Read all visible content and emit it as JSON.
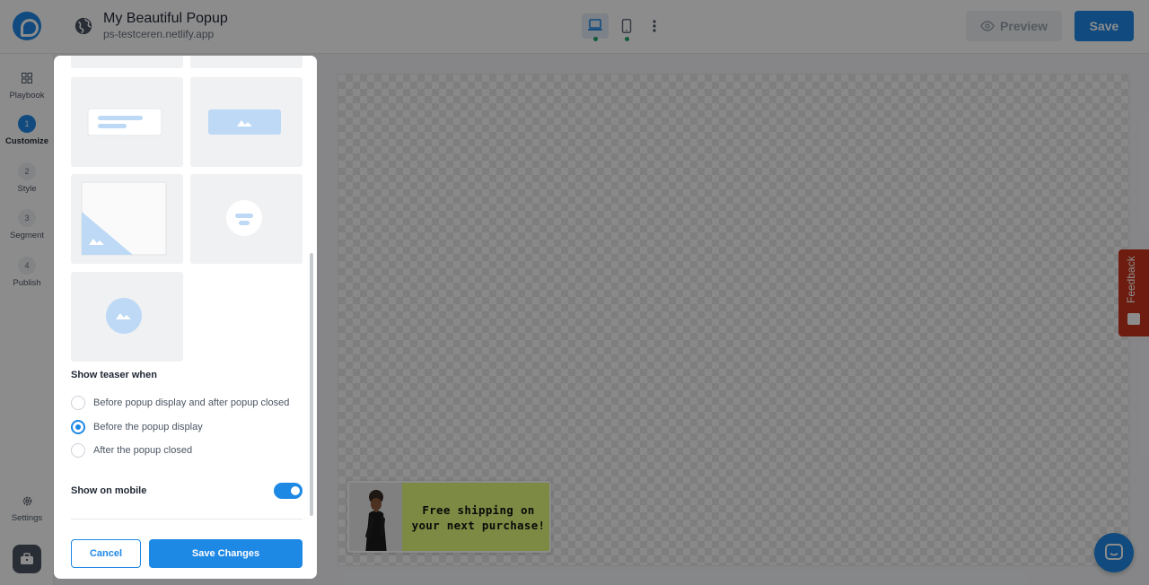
{
  "header": {
    "title": "My Beautiful Popup",
    "site": "ps-testceren.netlify.app",
    "preview_label": "Preview",
    "save_label": "Save"
  },
  "sidebar": {
    "items": [
      {
        "badge": "",
        "label": "Playbook",
        "icon": "grid-icon"
      },
      {
        "badge": "1",
        "label": "Customize",
        "active": true
      },
      {
        "badge": "2",
        "label": "Style"
      },
      {
        "badge": "3",
        "label": "Segment"
      },
      {
        "badge": "4",
        "label": "Publish"
      },
      {
        "badge": "",
        "label": "Settings",
        "icon": "gear-icon"
      }
    ]
  },
  "canvas": {
    "teaser_text": "Free shipping on your next purchase!"
  },
  "feedback_label": "Feedback",
  "modal": {
    "teaser_title": "Show teaser when",
    "options": [
      {
        "label": "Before popup display and after popup closed",
        "checked": false
      },
      {
        "label": "Before the popup display",
        "checked": true
      },
      {
        "label": "After the popup closed",
        "checked": false
      }
    ],
    "mobile_label": "Show on mobile",
    "mobile_enabled": true,
    "cancel_label": "Cancel",
    "save_changes_label": "Save Changes"
  },
  "colors": {
    "accent": "#1e88e5",
    "teaser_bg": "#e4fb7a",
    "feedback_bg": "#c8331c"
  }
}
